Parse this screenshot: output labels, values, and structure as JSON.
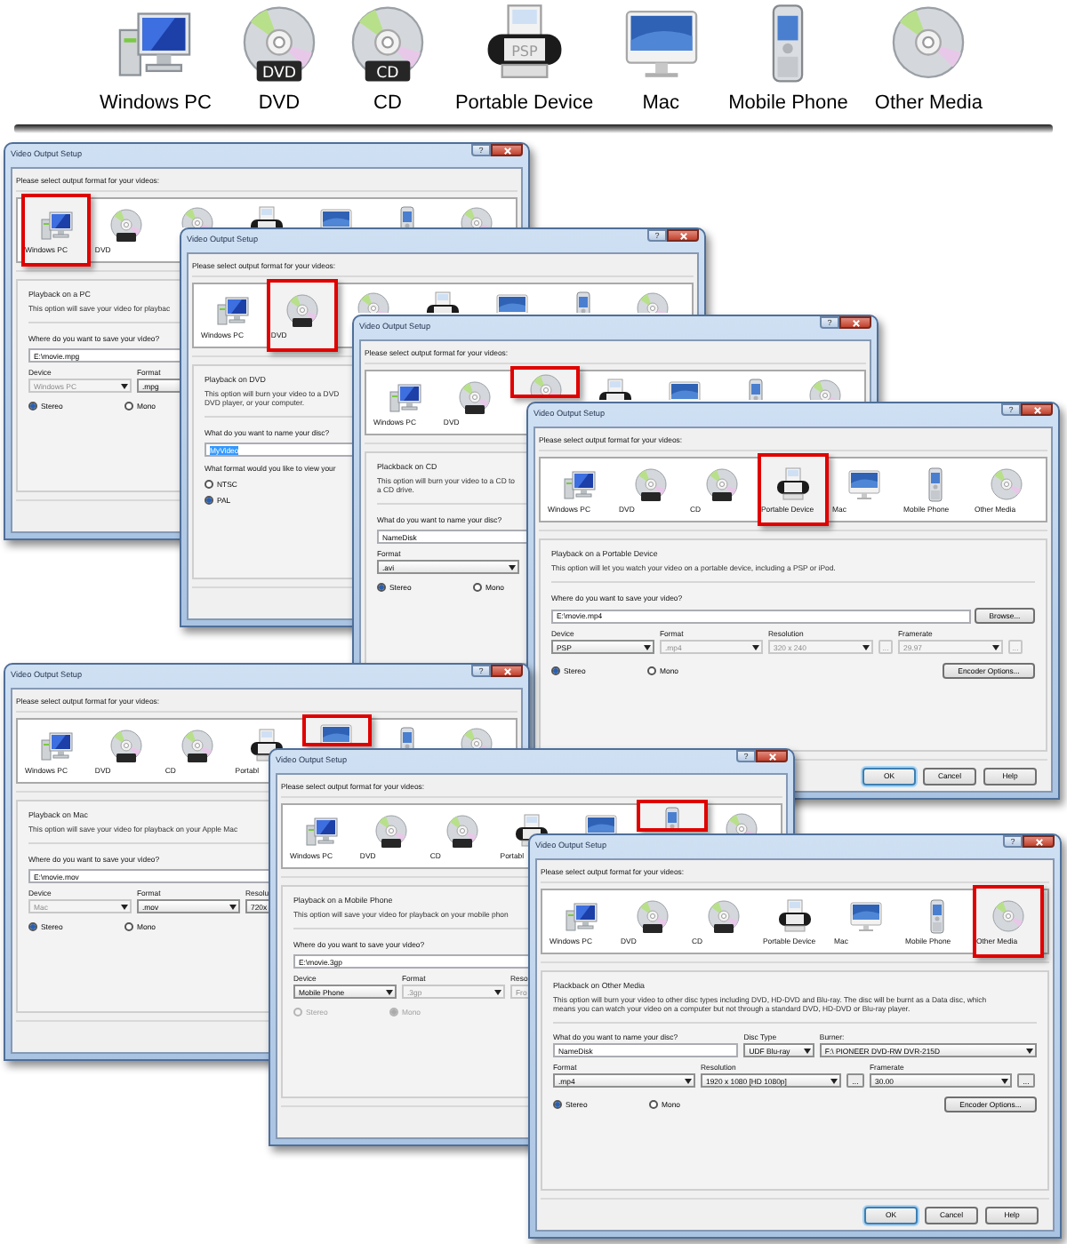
{
  "strip": [
    {
      "label": "Windows PC"
    },
    {
      "label": "DVD",
      "badge": "DVD"
    },
    {
      "label": "CD",
      "badge": "CD"
    },
    {
      "label": "Portable Device",
      "badge": "PSP"
    },
    {
      "label": "Mac"
    },
    {
      "label": "Mobile Phone"
    },
    {
      "label": "Other Media"
    }
  ],
  "windows": [
    {
      "title": "Video Output Setup",
      "help": "?",
      "prompt": "Please select output format for your videos:",
      "formats": [
        {
          "label": "Windows PC",
          "selected": true
        },
        {
          "label": "DVD",
          "selected": false
        },
        {
          "selected": false
        },
        {
          "selected": false
        },
        {
          "selected": false
        },
        {
          "selected": false
        },
        {
          "selected": false
        }
      ],
      "group": [
        {
          "kind": "heading",
          "text": "Playback on a PC"
        },
        {
          "kind": "description",
          "lines": [
            "This option will save your video for playbac"
          ]
        },
        {
          "kind": "rule"
        },
        {
          "kind": "question",
          "text": "Where do you want to save your video?"
        },
        {
          "kind": "path",
          "value": "E:\\movie.mpg"
        },
        {
          "kind": "device-row",
          "fields": [
            {
              "kind": "select",
              "label": "Device",
              "value": "Windows PC",
              "disabled": true
            },
            {
              "kind": "select",
              "label": "Format",
              "value": ".mpg",
              "disabled": false
            }
          ]
        },
        {
          "kind": "audio-row",
          "options": [
            {
              "label": "Stereo",
              "selected": true,
              "disabled": false
            },
            {
              "label": "Mono",
              "selected": false,
              "disabled": false
            }
          ]
        }
      ]
    },
    {
      "title": "Video Output Setup",
      "help": "?",
      "prompt": "Please select output format for your videos:",
      "formats": [
        {
          "label": "Windows PC",
          "selected": false
        },
        {
          "label": "DVD",
          "selected": true
        },
        {
          "selected": false
        },
        {
          "selected": false
        },
        {
          "selected": false
        },
        {
          "selected": false
        },
        {
          "selected": false
        }
      ],
      "group": [
        {
          "kind": "heading",
          "text": "Playback on DVD"
        },
        {
          "kind": "description",
          "lines": [
            "This option will burn your video to a DVD",
            "DVD player, or your computer."
          ]
        },
        {
          "kind": "rule"
        },
        {
          "kind": "question",
          "text": "What do you want to name your disc?"
        },
        {
          "kind": "name",
          "value": "MyVideo",
          "highlighted": true
        },
        {
          "kind": "question",
          "text": "What format would you like to view your"
        },
        {
          "kind": "radio-list",
          "options": [
            {
              "label": "NTSC",
              "selected": false,
              "disabled": false
            },
            {
              "label": "PAL",
              "selected": true,
              "disabled": false
            }
          ]
        }
      ]
    },
    {
      "title": "Video Output Setup",
      "help": "?",
      "prompt": "Please select output format for your videos:",
      "formats": [
        {
          "label": "Windows PC",
          "selected": false
        },
        {
          "label": "DVD",
          "selected": false
        },
        {
          "selected": true
        },
        {
          "selected": false
        },
        {
          "selected": false
        },
        {
          "selected": false
        },
        {
          "selected": false
        }
      ],
      "group": [
        {
          "kind": "heading",
          "text": "Plackback on CD"
        },
        {
          "kind": "description",
          "lines": [
            "This option will burn your video to a CD to",
            "a CD drive."
          ]
        },
        {
          "kind": "rule"
        },
        {
          "kind": "question",
          "text": "What do you want to name your disc?"
        },
        {
          "kind": "name",
          "value": "NameDisk",
          "highlighted": false
        },
        {
          "kind": "media-row",
          "fields": [
            {
              "kind": "select",
              "label": "Format",
              "value": ".avi",
              "disabled": false
            }
          ]
        },
        {
          "kind": "audio-row",
          "options": [
            {
              "label": "Stereo",
              "selected": true,
              "disabled": false
            },
            {
              "label": "Mono",
              "selected": false,
              "disabled": false
            }
          ]
        }
      ]
    },
    {
      "title": "Video Output Setup",
      "help": "?",
      "prompt": "Please select output format for your videos:",
      "formats": [
        {
          "label": "Windows PC",
          "selected": false
        },
        {
          "label": "DVD",
          "selected": false
        },
        {
          "label": "CD",
          "selected": false
        },
        {
          "label": "Portable Device",
          "selected": true
        },
        {
          "label": "Mac",
          "selected": false
        },
        {
          "label": "Mobile Phone",
          "selected": false
        },
        {
          "label": "Other Media",
          "selected": false
        }
      ],
      "group": [
        {
          "kind": "heading",
          "text": "Playback on a Portable Device"
        },
        {
          "kind": "description",
          "lines": [
            "This option will let you watch your video on a portable device, including a PSP or iPod."
          ]
        },
        {
          "kind": "rule"
        },
        {
          "kind": "question",
          "text": "Where do you want to save your video?"
        },
        {
          "kind": "path",
          "value": "E:\\movie.mp4",
          "button": "Browse..."
        },
        {
          "kind": "device-row",
          "fields": [
            {
              "kind": "select",
              "label": "Device",
              "value": "PSP",
              "disabled": false
            },
            {
              "kind": "select",
              "label": "Format",
              "value": ".mp4",
              "disabled": true
            },
            {
              "kind": "select",
              "label": "Resolution",
              "value": "320 x 240",
              "disabled": true
            },
            {
              "kind": "more",
              "value": "...",
              "disabled": true
            },
            {
              "kind": "select",
              "label": "Framerate",
              "value": "29.97",
              "disabled": true
            },
            {
              "kind": "more",
              "value": "...",
              "disabled": true
            }
          ]
        },
        {
          "kind": "audio-row",
          "options": [
            {
              "label": "Stereo",
              "selected": true,
              "disabled": false
            },
            {
              "label": "Mono",
              "selected": false,
              "disabled": false
            }
          ],
          "button": "Encoder Options..."
        }
      ],
      "buttons": [
        {
          "label": "OK",
          "default": true
        },
        {
          "label": "Cancel",
          "default": false
        },
        {
          "label": "Help",
          "default": false
        }
      ]
    },
    {
      "title": "Video Output Setup",
      "help": "?",
      "prompt": "Please select output format for your videos:",
      "formats": [
        {
          "label": "Windows PC",
          "selected": false
        },
        {
          "label": "DVD",
          "selected": false
        },
        {
          "label": "CD",
          "selected": false
        },
        {
          "label": "Portabl",
          "selected": false
        },
        {
          "selected": true
        },
        {
          "selected": false
        },
        {
          "selected": false
        }
      ],
      "group": [
        {
          "kind": "heading",
          "text": "Playback on Mac"
        },
        {
          "kind": "description",
          "lines": [
            "This option will save your video for playback on your Apple Mac"
          ]
        },
        {
          "kind": "rule"
        },
        {
          "kind": "question",
          "text": "Where do you want to save your video?"
        },
        {
          "kind": "path",
          "value": "E:\\movie.mov"
        },
        {
          "kind": "device-row",
          "fields": [
            {
              "kind": "select",
              "label": "Device",
              "value": "Mac",
              "disabled": true
            },
            {
              "kind": "select",
              "label": "Format",
              "value": ".mov",
              "disabled": false
            },
            {
              "kind": "select",
              "label": "Resolu",
              "value": "720x",
              "disabled": false
            }
          ]
        },
        {
          "kind": "audio-row",
          "options": [
            {
              "label": "Stereo",
              "selected": true,
              "disabled": false
            },
            {
              "label": "Mono",
              "selected": false,
              "disabled": false
            }
          ]
        }
      ]
    },
    {
      "title": "Video Output Setup",
      "help": "?",
      "prompt": "Please select output format for your videos:",
      "formats": [
        {
          "label": "Windows PC",
          "selected": false
        },
        {
          "label": "DVD",
          "selected": false
        },
        {
          "label": "CD",
          "selected": false
        },
        {
          "label": "Portabl",
          "selected": false
        },
        {
          "selected": false
        },
        {
          "selected": true
        },
        {
          "selected": false
        }
      ],
      "group": [
        {
          "kind": "heading",
          "text": "Playback on a Mobile Phone"
        },
        {
          "kind": "description",
          "lines": [
            "This option will save your video for playback on your mobile phon"
          ]
        },
        {
          "kind": "rule"
        },
        {
          "kind": "question",
          "text": "Where do you want to save your video?"
        },
        {
          "kind": "path",
          "value": "E:\\movie.3gp"
        },
        {
          "kind": "device-row",
          "fields": [
            {
              "kind": "select",
              "label": "Device",
              "value": "Mobile Phone",
              "disabled": false
            },
            {
              "kind": "select",
              "label": "Format",
              "value": ".3gp",
              "disabled": true
            },
            {
              "kind": "select",
              "label": "Reso",
              "value": "Fro",
              "disabled": true
            }
          ]
        },
        {
          "kind": "audio-row",
          "options": [
            {
              "label": "Stereo",
              "selected": false,
              "disabled": true
            },
            {
              "label": "Mono",
              "selected": true,
              "disabled": true
            }
          ]
        }
      ]
    },
    {
      "title": "Video Output Setup",
      "help": "?",
      "prompt": "Please select output format for your videos:",
      "formats": [
        {
          "label": "Windows PC",
          "selected": false
        },
        {
          "label": "DVD",
          "selected": false
        },
        {
          "label": "CD",
          "selected": false
        },
        {
          "label": "Portable Device",
          "selected": false
        },
        {
          "label": "Mac",
          "selected": false
        },
        {
          "label": "Mobile Phone",
          "selected": false
        },
        {
          "label": "Other Media",
          "selected": true
        }
      ],
      "group": [
        {
          "kind": "heading",
          "text": "Plackback on Other Media"
        },
        {
          "kind": "description",
          "lines": [
            "This option will burn your video to other disc types including DVD, HD-DVD and Blu-ray. The disc will be burnt as a Data disc, which",
            "means you can watch your video on a computer but not through a standard DVD, HD-DVD or Blu-ray player."
          ]
        },
        {
          "kind": "rule"
        },
        {
          "kind": "disc-row",
          "fields": [
            {
              "kind": "input",
              "label": "What do you want to name your disc?",
              "value": "NameDisk",
              "disabled": false
            },
            {
              "kind": "select",
              "label": "Disc Type",
              "value": "UDF Blu-ray",
              "disabled": false
            },
            {
              "kind": "select",
              "label": "Burner:",
              "value": "F:\\ PIONEER  DVD-RW  DVR-215D",
              "disabled": false
            }
          ]
        },
        {
          "kind": "media-row",
          "fields": [
            {
              "kind": "select",
              "label": "Format",
              "value": ".mp4",
              "disabled": false
            },
            {
              "kind": "select",
              "label": "Resolution",
              "value": "1920 x 1080 [HD 1080p]",
              "disabled": false
            },
            {
              "kind": "more",
              "value": "...",
              "disabled": false
            },
            {
              "kind": "select",
              "label": "Framerate",
              "value": "30.00",
              "disabled": false
            },
            {
              "kind": "more",
              "value": "...",
              "disabled": false
            }
          ]
        },
        {
          "kind": "audio-row",
          "options": [
            {
              "label": "Stereo",
              "selected": true,
              "disabled": false
            },
            {
              "label": "Mono",
              "selected": false,
              "disabled": false
            }
          ],
          "button": "Encoder Options..."
        }
      ],
      "buttons": [
        {
          "label": "OK",
          "default": true
        },
        {
          "label": "Cancel",
          "default": false
        },
        {
          "label": "Help",
          "default": false
        }
      ]
    }
  ]
}
